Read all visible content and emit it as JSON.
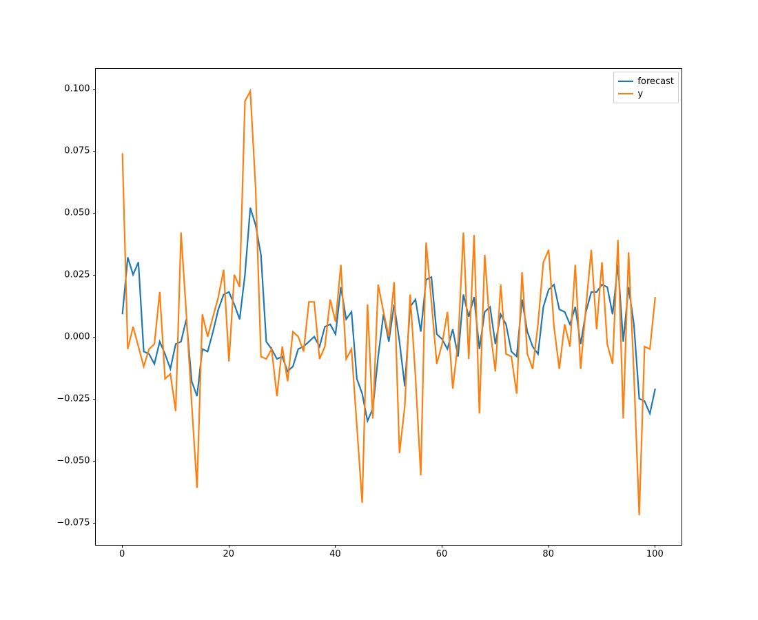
{
  "chart_data": {
    "type": "line",
    "x": [
      0,
      1,
      2,
      3,
      4,
      5,
      6,
      7,
      8,
      9,
      10,
      11,
      12,
      13,
      14,
      15,
      16,
      17,
      18,
      19,
      20,
      21,
      22,
      23,
      24,
      25,
      26,
      27,
      28,
      29,
      30,
      31,
      32,
      33,
      34,
      35,
      36,
      37,
      38,
      39,
      40,
      41,
      42,
      43,
      44,
      45,
      46,
      47,
      48,
      49,
      50,
      51,
      52,
      53,
      54,
      55,
      56,
      57,
      58,
      59,
      60,
      61,
      62,
      63,
      64,
      65,
      66,
      67,
      68,
      69,
      70,
      71,
      72,
      73,
      74,
      75,
      76,
      77,
      78,
      79,
      80,
      81,
      82,
      83,
      84,
      85,
      86,
      87,
      88,
      89,
      90,
      91,
      92,
      93,
      94,
      95,
      96,
      97,
      98,
      99,
      100
    ],
    "series": [
      {
        "name": "forecast",
        "color": "#1f77b4",
        "values": [
          0.009,
          0.032,
          0.025,
          0.03,
          -0.006,
          -0.007,
          -0.011,
          -0.002,
          -0.007,
          -0.013,
          -0.003,
          -0.002,
          0.007,
          -0.018,
          -0.024,
          -0.005,
          -0.006,
          0.002,
          0.011,
          0.017,
          0.018,
          0.013,
          0.007,
          0.025,
          0.052,
          0.045,
          0.033,
          -0.002,
          -0.005,
          -0.009,
          -0.008,
          -0.014,
          -0.012,
          -0.005,
          -0.004,
          -0.002,
          0.0,
          -0.004,
          0.004,
          0.005,
          0.001,
          0.02,
          0.007,
          0.01,
          -0.017,
          -0.023,
          -0.034,
          -0.029,
          -0.008,
          0.009,
          -0.002,
          0.013,
          -0.002,
          -0.02,
          0.012,
          0.015,
          0.002,
          0.023,
          0.024,
          0.001,
          -0.001,
          -0.005,
          0.003,
          -0.008,
          0.017,
          0.008,
          0.016,
          -0.005,
          0.01,
          0.012,
          -0.003,
          0.009,
          0.005,
          -0.006,
          -0.008,
          0.015,
          0.002,
          -0.004,
          -0.007,
          0.012,
          0.019,
          0.021,
          0.011,
          0.01,
          0.005,
          0.012,
          -0.003,
          0.01,
          0.018,
          0.018,
          0.021,
          0.02,
          0.009,
          0.029,
          -0.002,
          0.02,
          0.005,
          -0.025,
          -0.026,
          -0.031,
          -0.021
        ]
      },
      {
        "name": "y",
        "color": "#ff7f0e",
        "values": [
          0.074,
          -0.005,
          0.004,
          -0.004,
          -0.012,
          -0.005,
          -0.003,
          0.018,
          -0.017,
          -0.015,
          -0.03,
          0.042,
          0.009,
          -0.027,
          -0.061,
          0.009,
          0.0,
          0.008,
          0.016,
          0.027,
          -0.01,
          0.025,
          0.02,
          0.095,
          0.099,
          0.06,
          -0.008,
          -0.009,
          -0.005,
          -0.024,
          -0.004,
          -0.018,
          0.002,
          0.0,
          -0.006,
          0.014,
          0.014,
          -0.009,
          -0.004,
          0.015,
          0.006,
          0.029,
          -0.009,
          -0.005,
          -0.036,
          -0.067,
          0.013,
          -0.033,
          0.021,
          0.01,
          0.0,
          0.022,
          -0.047,
          -0.028,
          0.017,
          -0.016,
          -0.056,
          0.038,
          0.014,
          -0.011,
          -0.003,
          0.01,
          -0.021,
          -0.002,
          0.042,
          -0.009,
          0.041,
          -0.031,
          0.033,
          0.003,
          -0.014,
          0.021,
          -0.007,
          -0.008,
          -0.023,
          0.026,
          -0.007,
          -0.013,
          0.005,
          0.03,
          0.035,
          0.004,
          -0.013,
          0.005,
          -0.004,
          0.029,
          -0.013,
          0.012,
          0.035,
          0.003,
          0.03,
          -0.003,
          -0.011,
          0.039,
          -0.033,
          0.034,
          -0.015,
          -0.072,
          -0.004,
          -0.005,
          0.016
        ]
      }
    ],
    "xlim": [
      -5,
      105
    ],
    "ylim": [
      -0.084,
      0.108
    ],
    "xticks": [
      0,
      20,
      40,
      60,
      80,
      100
    ],
    "yticks": [
      -0.075,
      -0.05,
      -0.025,
      0.0,
      0.025,
      0.05,
      0.075,
      0.1
    ],
    "ytick_labels": [
      "−0.075",
      "−0.050",
      "−0.025",
      "0.000",
      "0.025",
      "0.050",
      "0.075",
      "0.100"
    ],
    "title": "",
    "xlabel": "",
    "ylabel": "",
    "legend_loc": "upper right"
  }
}
